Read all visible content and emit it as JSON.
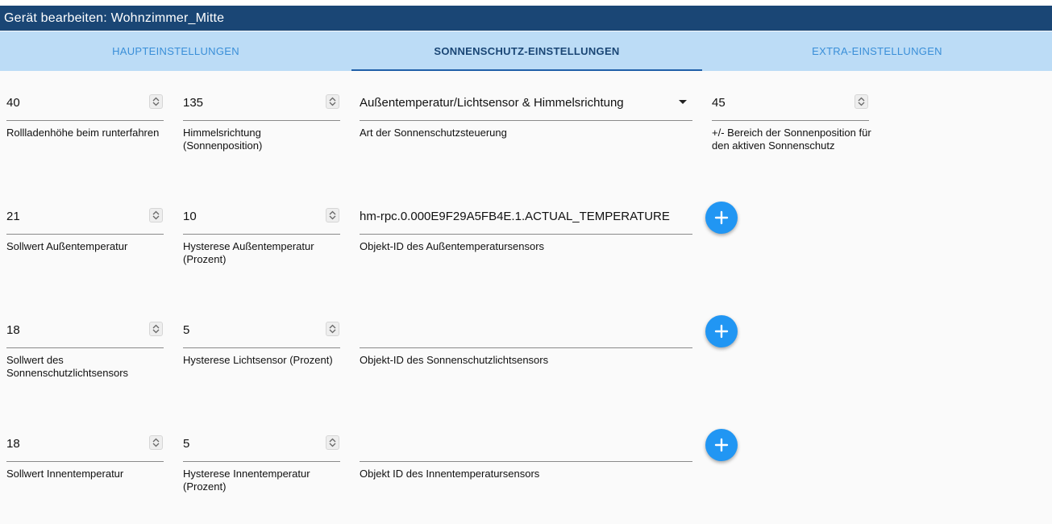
{
  "dialog": {
    "title": "Gerät bearbeiten: Wohnzimmer_Mitte"
  },
  "tabs": [
    {
      "label": "HAUPTEINSTELLUNGEN"
    },
    {
      "label": "SONNENSCHUTZ-EINSTELLUNGEN"
    },
    {
      "label": "EXTRA-EINSTELLUNGEN"
    }
  ],
  "row1": {
    "shutter_height": {
      "value": "40",
      "label": "Rollladenhöhe beim runterfahren"
    },
    "direction": {
      "value": "135",
      "label": "Himmelsrichtung (Sonnenposition)"
    },
    "control_type": {
      "value": "Außentemperatur/Lichtsensor & Himmelsrichtung",
      "label": "Art der Sonnenschutzsteuerung"
    },
    "sun_range": {
      "value": "45",
      "label": "+/- Bereich der Sonnenposition für den aktiven Sonnenschutz"
    }
  },
  "row2": {
    "setpoint": {
      "value": "21",
      "label": "Sollwert Außentemperatur"
    },
    "hysteresis": {
      "value": "10",
      "label": "Hysterese Außentemperatur (Prozent)"
    },
    "object_id": {
      "value": "hm-rpc.0.000E9F29A5FB4E.1.ACTUAL_TEMPERATURE",
      "label": "Objekt-ID des Außentemperatursensors"
    }
  },
  "row3": {
    "setpoint": {
      "value": "18",
      "label": "Sollwert des Sonnenschutzlichtsensors"
    },
    "hysteresis": {
      "value": "5",
      "label": "Hysterese Lichtsensor (Prozent)"
    },
    "object_id": {
      "value": "",
      "label": "Objekt-ID des Sonnenschutzlichtsensors"
    }
  },
  "row4": {
    "setpoint": {
      "value": "18",
      "label": "Sollwert Innentemperatur"
    },
    "hysteresis": {
      "value": "5",
      "label": "Hysterese Innentemperatur (Prozent)"
    },
    "object_id": {
      "value": "",
      "label": "Objekt ID des Innentemperatursensors"
    }
  },
  "colors": {
    "titlebar": "#1a4675",
    "tabbar": "#bcdcf6",
    "accent": "#2196f3"
  },
  "icons": {
    "add": "plus-icon",
    "spinner": "spinner-arrows-icon",
    "select": "caret-down-icon"
  }
}
